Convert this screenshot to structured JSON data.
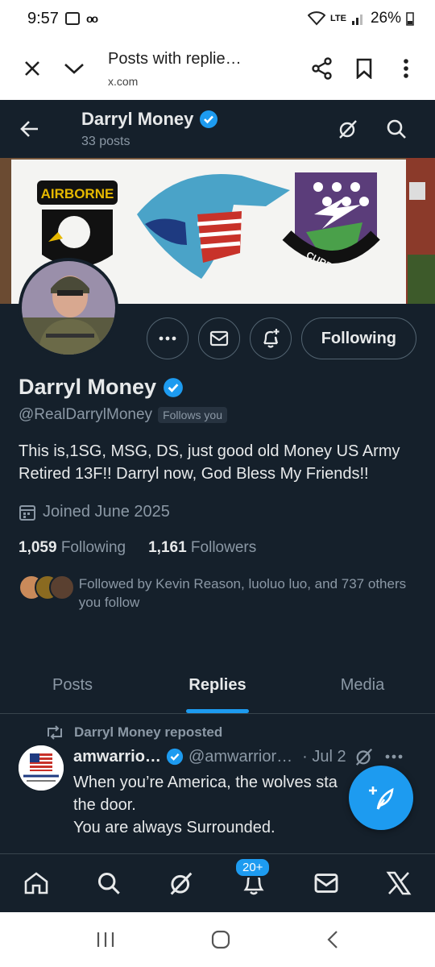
{
  "status_bar": {
    "time": "9:57",
    "network": "LTE",
    "battery": "26%"
  },
  "browser": {
    "page_title": "Posts with replie…",
    "url": "x.com"
  },
  "header": {
    "name": "Darryl Money",
    "posts_count": "33 posts"
  },
  "profile": {
    "name": "Darryl Money",
    "handle": "@RealDarrylMoney",
    "follows_you": "Follows you",
    "bio": "This is,1SG, MSG, DS, just good old Money US Army Retired 13F!! Darryl now, God Bless My Friends!!",
    "joined": "Joined June 2025",
    "following_count": "1,059",
    "following_label": "Following",
    "followers_count": "1,161",
    "followers_label": "Followers",
    "followed_by": "Followed by Kevin Reason, luoluo luo, and 737 others you follow"
  },
  "banner": {
    "patch_left_text": "AIRBORNE",
    "patch_right_text": "CURRAHEE"
  },
  "actions": {
    "following_button": "Following"
  },
  "tabs": [
    {
      "label": "Posts"
    },
    {
      "label": "Replies"
    },
    {
      "label": "Media"
    }
  ],
  "active_tab": "Replies",
  "post": {
    "repost_label": "Darryl Money reposted",
    "author_name": "amwarrio…",
    "author_handle": "@amwarrior…",
    "date": "· Jul 2",
    "text_line1": "When you’re America, the wolves sta",
    "text_line2": "the door.",
    "text_line3": "You are always Surrounded."
  },
  "bottom_nav": {
    "notifications_badge": "20+"
  },
  "colors": {
    "background": "#15202b",
    "accent": "#1d9bf0",
    "muted": "#8b98a5",
    "border": "#38444d"
  }
}
